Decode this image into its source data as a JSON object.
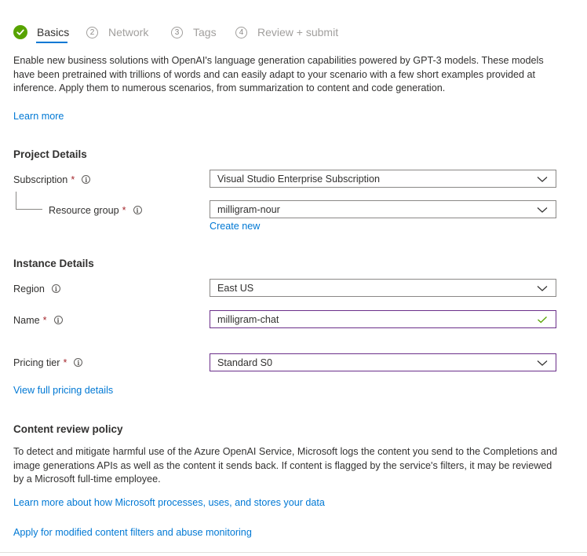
{
  "tabs": [
    {
      "number": "",
      "label": "Basics",
      "state": "completed"
    },
    {
      "number": "2",
      "label": "Network",
      "state": "inactive"
    },
    {
      "number": "3",
      "label": "Tags",
      "state": "inactive"
    },
    {
      "number": "4",
      "label": "Review + submit",
      "state": "inactive"
    }
  ],
  "description": "Enable new business solutions with OpenAI's language generation capabilities powered by GPT-3 models. These models have been pretrained with trillions of words and can easily adapt to your scenario with a few short examples provided at inference. Apply them to numerous scenarios, from summarization to content and code generation.",
  "learn_more": "Learn more",
  "project_details": {
    "title": "Project Details",
    "subscription_label": "Subscription",
    "subscription_value": "Visual Studio Enterprise Subscription",
    "resource_group_label": "Resource group",
    "resource_group_value": "milligram-nour",
    "create_new": "Create new"
  },
  "instance_details": {
    "title": "Instance Details",
    "region_label": "Region",
    "region_value": "East US",
    "name_label": "Name",
    "name_value": "milligram-chat",
    "pricing_label": "Pricing tier",
    "pricing_value": "Standard S0",
    "pricing_link": "View full pricing details"
  },
  "content_review": {
    "title": "Content review policy",
    "text": "To detect and mitigate harmful use of the Azure OpenAI Service, Microsoft logs the content you send to the Completions and image generations APIs as well as the content it sends back. If content is flagged by the service's filters, it may be reviewed by a Microsoft full-time employee.",
    "link1": "Learn more about how Microsoft processes, uses, and stores your data",
    "link2": "Apply for modified content filters and abuse monitoring"
  },
  "required_marker": "*",
  "info_glyph": "i",
  "colors": {
    "link": "#0078d4",
    "required": "#a4262c",
    "success": "#57a300",
    "focus_border": "#6b2f8a"
  }
}
